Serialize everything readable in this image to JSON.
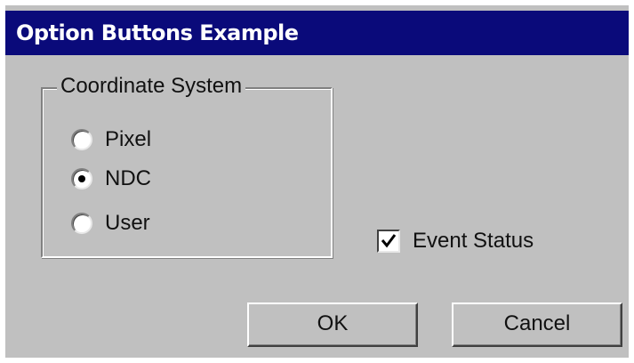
{
  "window": {
    "title": "Option Buttons Example"
  },
  "coordinate_group": {
    "legend": "Coordinate System",
    "options": [
      {
        "label": "Pixel",
        "selected": false
      },
      {
        "label": "NDC",
        "selected": true
      },
      {
        "label": "User",
        "selected": false
      }
    ]
  },
  "event_status": {
    "label": "Event Status",
    "checked": true
  },
  "buttons": {
    "ok_label": "OK",
    "cancel_label": "Cancel"
  },
  "colors": {
    "titlebar_bg": "#0a0a7a",
    "dialog_bg": "#c0c0c0"
  }
}
